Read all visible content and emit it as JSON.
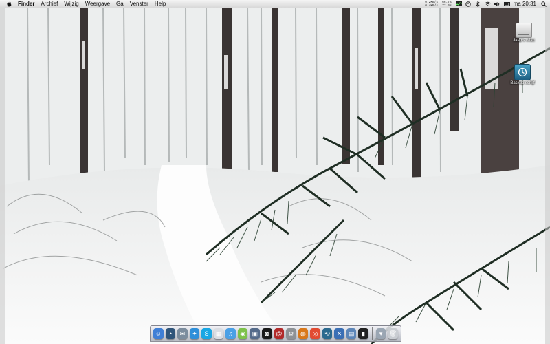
{
  "menubar": {
    "items": [
      "Finder",
      "Archief",
      "Wijzig",
      "Weergave",
      "Ga",
      "Venster",
      "Help"
    ],
    "stats_left": [
      "0.2KB/s",
      "0.4KB/s"
    ],
    "stats_right": [
      "66.7%",
      "77.5%"
    ],
    "clock": "ma 20:31"
  },
  "desktop_icons": [
    {
      "label": "Jaap's iMac",
      "icon": "hard-drive-icon"
    },
    {
      "label": "Backup schijf",
      "icon": "time-machine-disk-icon"
    }
  ],
  "dock": {
    "items": [
      {
        "name": "finder-icon",
        "color": "#3f7fd6",
        "glyph": "☺"
      },
      {
        "name": "dashboard-icon",
        "color": "#30557a",
        "glyph": "◔"
      },
      {
        "name": "mail-icon",
        "color": "#7c8d9e",
        "glyph": "✉"
      },
      {
        "name": "safari-icon",
        "color": "#2f8fd9",
        "glyph": "✦"
      },
      {
        "name": "skype-icon",
        "color": "#19a7e4",
        "glyph": "S"
      },
      {
        "name": "ical-icon",
        "color": "#d9dde3",
        "glyph": "▦"
      },
      {
        "name": "itunes-icon",
        "color": "#4aa0e6",
        "glyph": "♫"
      },
      {
        "name": "adium-icon",
        "color": "#7dc24a",
        "glyph": "◉"
      },
      {
        "name": "iphoto-icon",
        "color": "#556b8a",
        "glyph": "▣"
      },
      {
        "name": "photobooth-icon",
        "color": "#1a1a1a",
        "glyph": "◙"
      },
      {
        "name": "address-book-icon",
        "color": "#b22a2a",
        "glyph": "@"
      },
      {
        "name": "system-preferences-icon",
        "color": "#8e9296",
        "glyph": "⚙"
      },
      {
        "name": "firefox-icon",
        "color": "#d9781a",
        "glyph": "◍"
      },
      {
        "name": "chrome-icon",
        "color": "#e24b32",
        "glyph": "◎"
      },
      {
        "name": "time-machine-icon",
        "color": "#2b6a8f",
        "glyph": "⟲"
      },
      {
        "name": "xcode-icon",
        "color": "#3a6fb5",
        "glyph": "✕"
      },
      {
        "name": "preview-icon",
        "color": "#5d86b8",
        "glyph": "▤"
      },
      {
        "name": "terminal-icon",
        "color": "#222222",
        "glyph": "▮"
      },
      {
        "name": "downloads-stack-icon",
        "color": "#9aa6b3",
        "glyph": "▾"
      },
      {
        "name": "trash-icon",
        "color": "#c9cdd2",
        "glyph": "🗑"
      }
    ]
  }
}
